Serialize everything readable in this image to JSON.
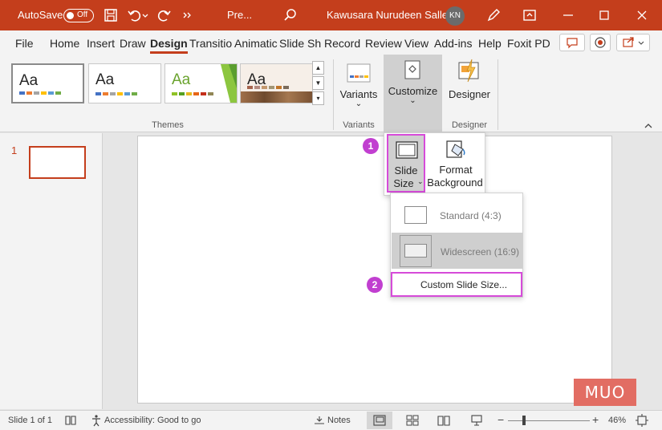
{
  "title_bar": {
    "autosave_label": "AutoSave",
    "autosave_state": "Off",
    "file_name": "Pre...",
    "user_name": "Kawusara Nurudeen Salley",
    "user_initials": "KN"
  },
  "menu": {
    "tabs": [
      "File",
      "Home",
      "Insert",
      "Draw",
      "Design",
      "Transitio",
      "Animatic",
      "Slide Sh",
      "Record",
      "Review",
      "View",
      "Add-ins",
      "Help",
      "Foxit PD"
    ],
    "active_tab": "Design"
  },
  "ribbon": {
    "themes_group_label": "Themes",
    "theme_sample_text": "Aa",
    "variants_label": "Variants",
    "variants_group_label": "Variants",
    "customize_label": "Customize",
    "designer_label": "Designer",
    "designer_group_label": "Designer"
  },
  "customize_dropdown": {
    "slide_size_line1": "Slide",
    "slide_size_line2": "Size",
    "format_bg_line1": "Format",
    "format_bg_line2": "Background"
  },
  "slide_size_menu": {
    "standard": "Standard (4:3)",
    "widescreen": "Widescreen (16:9)",
    "custom": "Custom Slide Size..."
  },
  "callouts": {
    "step1": "1",
    "step2": "2"
  },
  "thumbnails": {
    "slide_number": "1"
  },
  "status_bar": {
    "slide_info": "Slide 1 of 1",
    "accessibility": "Accessibility: Good to go",
    "notes": "Notes",
    "zoom": "46%"
  },
  "watermark": "MUO",
  "colors": {
    "accent": "#c43e1c",
    "callout": "#c13fd0",
    "highlight_border": "#d64bd9"
  }
}
